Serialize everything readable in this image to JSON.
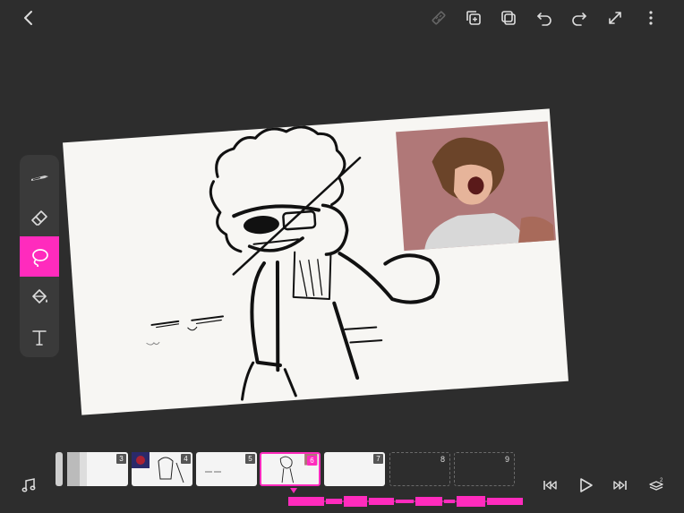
{
  "colors": {
    "accent": "#ff2bbd",
    "background": "#2d2d2d",
    "palette": "#3a3a3a"
  },
  "topbar": {
    "icons": [
      "back-icon",
      "ruler-icon",
      "duplicate-frame-icon",
      "copy-frame-icon",
      "undo-icon",
      "redo-icon",
      "expand-icon",
      "more-icon"
    ]
  },
  "tools": {
    "items": [
      "pen",
      "eraser",
      "lasso",
      "fill",
      "text"
    ],
    "active": "lasso"
  },
  "timeline": {
    "frames": [
      {
        "num": "3",
        "state": "filled"
      },
      {
        "num": "4",
        "state": "filled"
      },
      {
        "num": "5",
        "state": "filled"
      },
      {
        "num": "6",
        "state": "selected"
      },
      {
        "num": "7",
        "state": "filled"
      },
      {
        "num": "8",
        "state": "empty"
      },
      {
        "num": "9",
        "state": "empty"
      }
    ],
    "current_frame": 6,
    "controls": [
      "music-icon",
      "skip-back-icon",
      "play-icon",
      "skip-forward-icon",
      "onion-skin-icon"
    ]
  }
}
